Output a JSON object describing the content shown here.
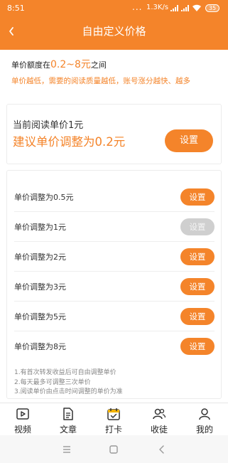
{
  "status_bar": {
    "time": "8:51",
    "dots": "...",
    "net_speed": "1.3K/s",
    "battery": "35"
  },
  "header": {
    "back_icon": "chevron-left-icon",
    "title": "自由定义价格"
  },
  "info": {
    "range_prefix": "单价额度在",
    "range_value": "0.2~8元",
    "range_suffix": "之间",
    "hint": "单价越低，需要的阅读质量越低，账号涨分越快、越多"
  },
  "current": {
    "label": "当前阅读单价1元",
    "suggestion": "建议单价调整为0.2元",
    "button": "设置"
  },
  "options": [
    {
      "label": "单价调整为0.5元",
      "button": "设置",
      "enabled": true
    },
    {
      "label": "单价调整为1元",
      "button": "设置",
      "enabled": false
    },
    {
      "label": "单价调整为2元",
      "button": "设置",
      "enabled": true
    },
    {
      "label": "单价调整为3元",
      "button": "设置",
      "enabled": true
    },
    {
      "label": "单价调整为5元",
      "button": "设置",
      "enabled": true
    },
    {
      "label": "单价调整为8元",
      "button": "设置",
      "enabled": true
    }
  ],
  "notes": [
    "1.有首次转发收益后可自由调整单价",
    "2.每天最多可调整三次单价",
    "3.阅读单价由点击时间调整的单价为准"
  ],
  "tabs": [
    {
      "label": "视频",
      "icon": "video-icon"
    },
    {
      "label": "文章",
      "icon": "article-icon"
    },
    {
      "label": "打卡",
      "icon": "calendar-check-icon"
    },
    {
      "label": "收徒",
      "icon": "apprentice-icon"
    },
    {
      "label": "我的",
      "icon": "profile-icon"
    }
  ],
  "colors": {
    "accent": "#f4842a",
    "disabled": "#cfcfcf"
  }
}
